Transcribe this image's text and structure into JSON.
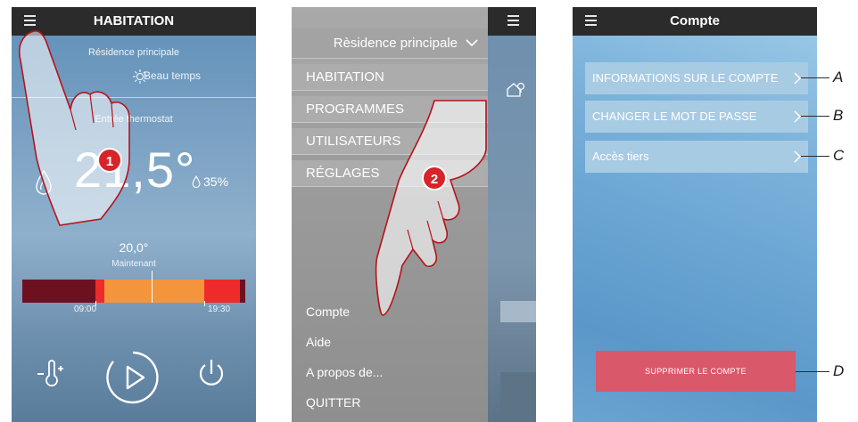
{
  "screen1": {
    "title": "HABITATION",
    "location": "Résidence principale",
    "weather": "Beau temps",
    "thermostat_label": "Entrée thermostat",
    "temperature": "21,5°",
    "humidity": "35%",
    "setpoint": "20,0°",
    "now_label": "Maintenant",
    "time_start": "09:00",
    "time_end": "19:30",
    "step_badge": "1"
  },
  "screen2": {
    "location": "Rèsidence principale",
    "menu_items": [
      "HABITATION",
      "PROGRAMMES",
      "UTILISATEURS",
      "RÉGLAGES"
    ],
    "lower_items": [
      "Compte",
      "Aide",
      "A propos de...",
      "QUITTER"
    ],
    "step_badge": "2"
  },
  "screen3": {
    "title": "Compte",
    "buttons": [
      "INFORMATIONS SUR LE COMPTE",
      "CHANGER LE MOT DE PASSE",
      "Accès tiers"
    ],
    "delete_label": "SUPPRIMER LE COMPTE",
    "callouts": [
      "A",
      "B",
      "C",
      "D"
    ]
  },
  "colors": {
    "statusbar": "#2b2b2b",
    "badge": "#d8232a",
    "delete_button": "#d9586a",
    "time_dark_red": "#6d1020",
    "time_orange": "#f5953b",
    "time_red": "#ef2a2a"
  },
  "icons": [
    "hamburger-icon",
    "sun-icon",
    "flame-drop-icon",
    "humidity-drop-icon",
    "thermometer-plus-icon",
    "play-icon",
    "power-icon",
    "chevron-down-icon",
    "home-icon",
    "chevron-right-icon"
  ]
}
